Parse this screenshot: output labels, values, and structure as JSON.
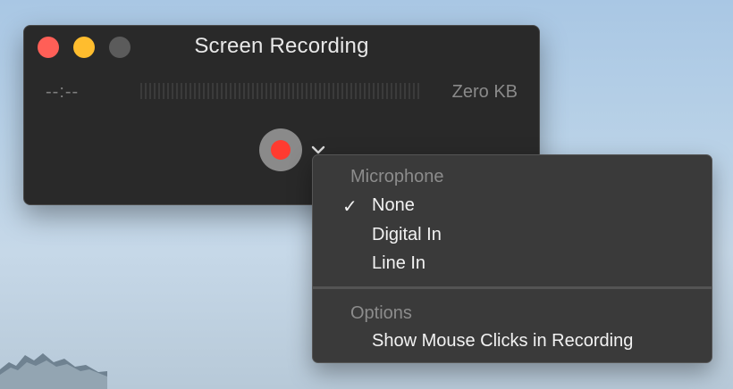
{
  "window": {
    "title": "Screen Recording",
    "elapsed_time": "--:--",
    "file_size": "Zero KB"
  },
  "menu": {
    "microphone_title": "Microphone",
    "microphone_items": [
      {
        "label": "None",
        "checked": true
      },
      {
        "label": "Digital In",
        "checked": false
      },
      {
        "label": "Line In",
        "checked": false
      }
    ],
    "checkmark": "✓",
    "options_title": "Options",
    "options_items": [
      {
        "label": "Show Mouse Clicks in Recording",
        "checked": false
      }
    ]
  },
  "icons": {
    "record": "record-icon",
    "chevron": "chevron-down-icon"
  },
  "colors": {
    "close": "#ff5f57",
    "minimize": "#ffbd2e",
    "zoom": "#5b5b5b",
    "record": "#ff3b30"
  }
}
